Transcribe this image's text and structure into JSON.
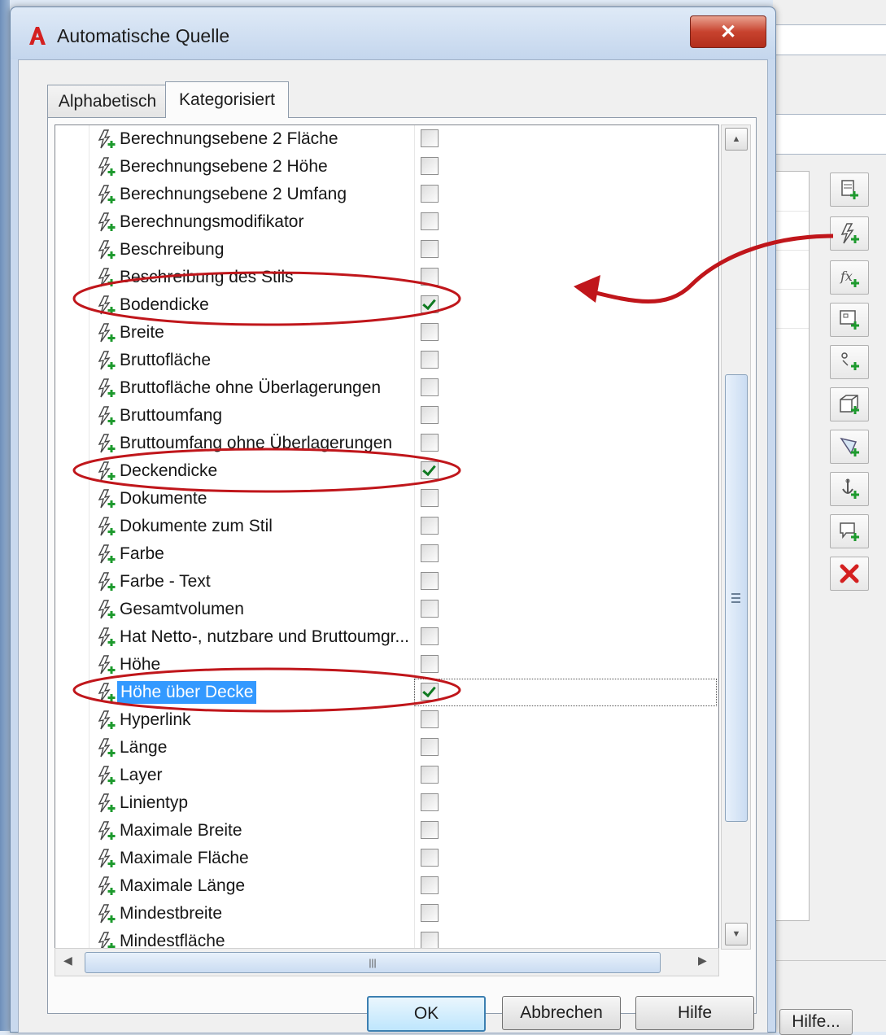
{
  "dialog": {
    "title": "Automatische Quelle",
    "close_icon": "close-icon",
    "tabs": [
      {
        "label": "Alphabetisch",
        "active": false
      },
      {
        "label": "Kategorisiert",
        "active": true
      }
    ],
    "rows": [
      {
        "name": "Berechnungsebene 2 Fläche",
        "checked": false
      },
      {
        "name": "Berechnungsebene 2 Höhe",
        "checked": false
      },
      {
        "name": "Berechnungsebene 2 Umfang",
        "checked": false
      },
      {
        "name": "Berechnungsmodifikator",
        "checked": false
      },
      {
        "name": "Beschreibung",
        "checked": false
      },
      {
        "name": "Beschreibung des Stils",
        "checked": false
      },
      {
        "name": "Bodendicke",
        "checked": true
      },
      {
        "name": "Breite",
        "checked": false
      },
      {
        "name": "Bruttofläche",
        "checked": false
      },
      {
        "name": "Bruttofläche ohne Überlagerungen",
        "checked": false
      },
      {
        "name": "Bruttoumfang",
        "checked": false
      },
      {
        "name": "Bruttoumfang ohne Überlagerungen",
        "checked": false
      },
      {
        "name": "Deckendicke",
        "checked": true
      },
      {
        "name": "Dokumente",
        "checked": false
      },
      {
        "name": "Dokumente zum Stil",
        "checked": false
      },
      {
        "name": "Farbe",
        "checked": false
      },
      {
        "name": "Farbe - Text",
        "checked": false
      },
      {
        "name": "Gesamtvolumen",
        "checked": false
      },
      {
        "name": "Hat Netto-, nutzbare und Bruttoumgr...",
        "checked": false
      },
      {
        "name": "Höhe",
        "checked": false
      },
      {
        "name": "Höhe über Decke",
        "checked": true,
        "selected": true
      },
      {
        "name": "Hyperlink",
        "checked": false
      },
      {
        "name": "Länge",
        "checked": false
      },
      {
        "name": "Layer",
        "checked": false
      },
      {
        "name": "Linientyp",
        "checked": false
      },
      {
        "name": "Maximale Breite",
        "checked": false
      },
      {
        "name": "Maximale Fläche",
        "checked": false
      },
      {
        "name": "Maximale Länge",
        "checked": false
      },
      {
        "name": "Mindestbreite",
        "checked": false
      },
      {
        "name": "Mindestfläche",
        "checked": false
      }
    ],
    "buttons": {
      "ok": "OK",
      "cancel": "Abbrechen",
      "help": "Hilfe"
    }
  },
  "background_window": {
    "help_button": "Hilfe...",
    "toolbar_icons": [
      "add-property-icon",
      "automatic-source-icon",
      "formula-icon",
      "location-icon",
      "classification-icon",
      "material-icon",
      "graphic-icon",
      "anchor-icon",
      "property-set-icon",
      "delete-icon"
    ]
  },
  "colors": {
    "selection": "#3399ff",
    "annotation": "#c0161b",
    "check": "#0f7a21"
  }
}
